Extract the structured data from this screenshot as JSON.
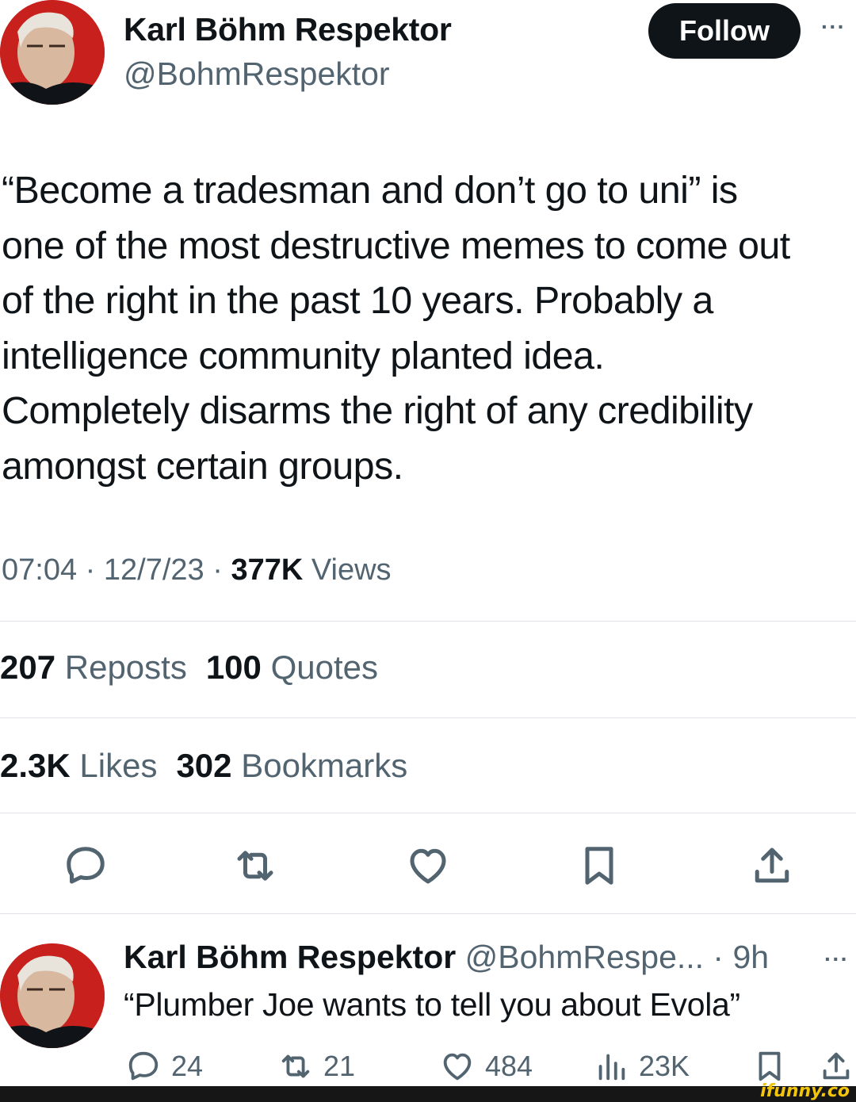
{
  "author": {
    "display_name": "Karl Böhm Respektor",
    "handle": "@BohmRespektor"
  },
  "follow_label": "Follow",
  "more_label": "···",
  "tweet": {
    "lines": [
      "“Become a tradesman and don’t go to uni” is",
      "one of the most destructive memes to come out",
      "of the right in the past 10 years. Probably a",
      "intelligence community planted idea.",
      "Completely disarms the right of any credibility",
      "amongst certain groups."
    ],
    "time": "07:04",
    "date": "12/7/23",
    "views_count": "377K",
    "views_label": "Views",
    "separator": "·"
  },
  "stats": {
    "reposts_count": "207",
    "reposts_label": "Reposts",
    "quotes_count": "100",
    "quotes_label": "Quotes",
    "likes_count": "2.3K",
    "likes_label": "Likes",
    "bookmarks_count": "302",
    "bookmarks_label": "Bookmarks"
  },
  "icons": [
    "reply-icon",
    "repost-icon",
    "like-icon",
    "bookmark-icon",
    "share-icon",
    "views-icon"
  ],
  "reply": {
    "display_name": "Karl Böhm Respektor",
    "meta": "@BohmRespe... · 9h",
    "text": "“Plumber Joe wants to tell you about Evola”",
    "replies": "24",
    "reposts": "21",
    "likes": "484",
    "views": "23K"
  },
  "watermark": "ifunny.co",
  "colors": {
    "text": "#0f1419",
    "secondary": "#536471",
    "divider": "#dfe3e7",
    "follow_bg": "#0f1419",
    "avatar_bg": "#c8201c"
  }
}
